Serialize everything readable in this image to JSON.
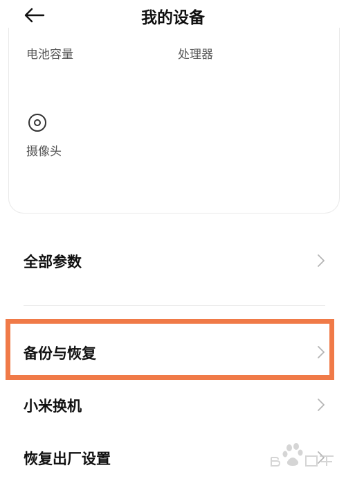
{
  "header": {
    "title": "我的设备",
    "back_icon": "arrow-left-icon"
  },
  "card": {
    "battery_label": "电池容量",
    "cpu_label": "处理器",
    "camera_label": "摄像头",
    "camera_icon": "camera-lens-icon"
  },
  "rows": {
    "all_params": "全部参数",
    "backup_restore": "备份与恢复",
    "mi_mover": "小米换机",
    "factory_reset": "恢复出厂设置"
  },
  "highlight_color": "#f07a48",
  "watermark_icon": "baidu-jingyan-watermark-icon"
}
